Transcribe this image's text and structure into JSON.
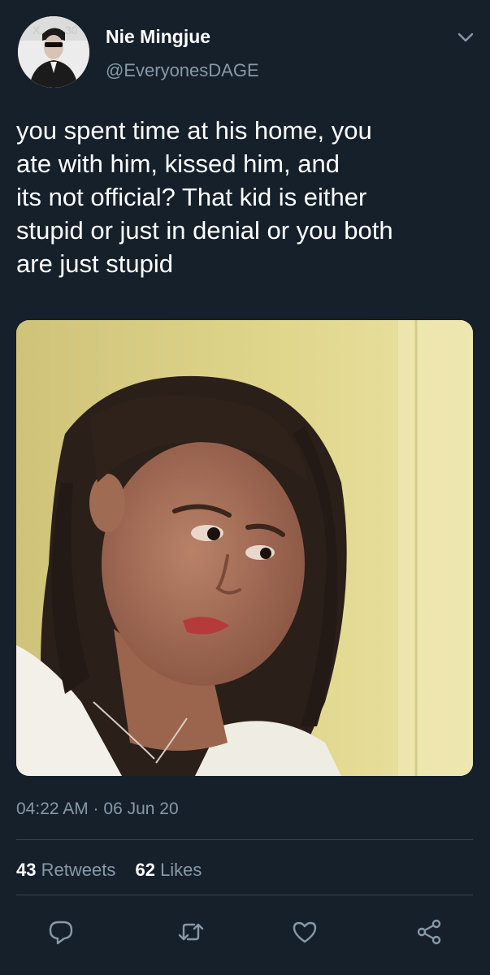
{
  "author": {
    "name": "Nie Mingjue",
    "handle": "@EveryonesDAGE"
  },
  "tweet": {
    "text": "you spent time at his home, you ate with him, kissed him, and its not official? That kid is either stupid or just in denial or you both are just stupid",
    "lines": [
      "you spent time at his home, you",
      "ate with him, kissed him, and",
      "its not official? That kid is either",
      "stupid or just in denial or you both",
      "are just stupid"
    ],
    "timestamp": "04:22 AM · 06 Jun 20"
  },
  "stats": {
    "retweets_count": "43",
    "retweets_label": "Retweets",
    "likes_count": "62",
    "likes_label": "Likes"
  },
  "icons": {
    "menu": "chevron-down-icon",
    "reply": "reply-icon",
    "retweet": "retweet-icon",
    "like": "heart-icon",
    "share": "share-icon"
  },
  "colors": {
    "background": "#15202b",
    "secondary_text": "#8899a6",
    "divider": "#38444d"
  }
}
